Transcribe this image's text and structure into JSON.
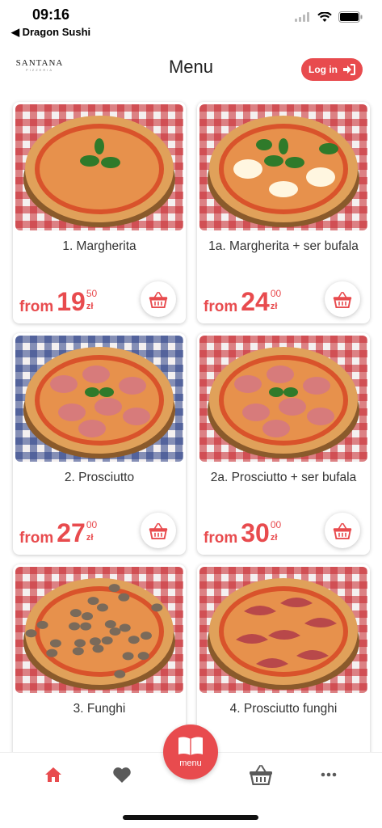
{
  "status_bar": {
    "time": "09:16",
    "back_app": "◀ Dragon Sushi"
  },
  "header": {
    "logo_text": "SANTANA",
    "logo_sub": "PIZZERIA",
    "title": "Menu",
    "login_label": "Log in"
  },
  "colors": {
    "accent": "#e84b4e",
    "tomato": "#d9532b",
    "cheese": "#f2c467",
    "crust": "#e0a15a",
    "cloth_red": "#c8262b",
    "cloth_blue": "#2a3f86"
  },
  "products": [
    {
      "name": "1. Margherita",
      "from": "from",
      "price_main": "19",
      "price_cents": "50",
      "currency": "zł",
      "cloth": "red",
      "topping": "basil"
    },
    {
      "name": "1a. Margherita + ser bufala",
      "from": "from",
      "price_main": "24",
      "price_cents": "00",
      "currency": "zł",
      "cloth": "red",
      "topping": "basil-mozzarella"
    },
    {
      "name": "2. Prosciutto",
      "from": "from",
      "price_main": "27",
      "price_cents": "00",
      "currency": "zł",
      "cloth": "blue",
      "topping": "ham"
    },
    {
      "name": "2a. Prosciutto + ser bufala",
      "from": "from",
      "price_main": "30",
      "price_cents": "00",
      "currency": "zł",
      "cloth": "red",
      "topping": "ham"
    },
    {
      "name": "3. Funghi",
      "from": "",
      "price_main": "",
      "price_cents": "",
      "currency": "",
      "cloth": "red",
      "topping": "mushroom"
    },
    {
      "name": "4. Prosciutto funghi",
      "from": "",
      "price_main": "",
      "price_cents": "",
      "currency": "",
      "cloth": "red",
      "topping": "prosciutto-crudo"
    }
  ],
  "tabbar": {
    "items": [
      {
        "icon": "home-icon",
        "active": true
      },
      {
        "icon": "heart-icon",
        "active": false
      },
      {
        "icon": "basket-icon",
        "active": false
      },
      {
        "icon": "more-icon",
        "active": false
      }
    ],
    "center_label": "menu"
  }
}
